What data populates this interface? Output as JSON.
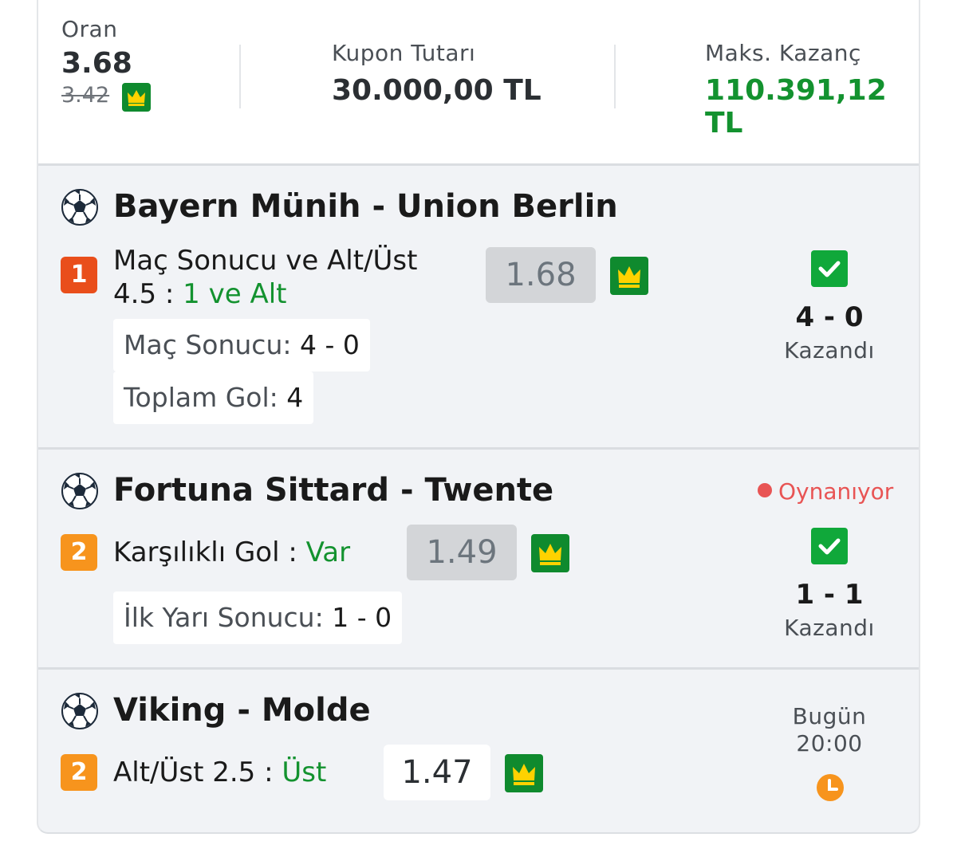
{
  "summary": {
    "odds_label": "Oran",
    "odds_value": "3.68",
    "odds_old": "3.42",
    "amount_label": "Kupon Tutarı",
    "amount_value": "30.000,00 TL",
    "max_win_label": "Maks. Kazanç",
    "max_win_value": "110.391,12 TL"
  },
  "matches": [
    {
      "title": "Bayern Münih - Union Berlin",
      "badge": "1",
      "badge_color": "#e94e1b",
      "market_line1": "Maç Sonucu ve Alt/Üst",
      "market_line2_prefix": "4.5 : ",
      "pick": "1 ve Alt",
      "odd": "1.68",
      "details": [
        {
          "label": "Maç Sonucu: ",
          "value": "4 - 0"
        },
        {
          "label": "Toplam Gol: ",
          "value": "4"
        }
      ],
      "score": "4 - 0",
      "status": "Kazandı"
    },
    {
      "title": "Fortuna Sittard - Twente",
      "live_label": "Oynanıyor",
      "badge": "2",
      "badge_color": "#f7941d",
      "market": "Karşılıklı Gol : ",
      "pick": "Var",
      "odd": "1.49",
      "details": [
        {
          "label": "İlk Yarı Sonucu: ",
          "value": "1 - 0"
        }
      ],
      "score": "1 - 1",
      "status": "Kazandı"
    },
    {
      "title": "Viking - Molde",
      "badge": "2",
      "badge_color": "#f7941d",
      "market": "Alt/Üst 2.5 : ",
      "pick": "Üst",
      "odd": "1.47",
      "day": "Bugün",
      "time": "20:00"
    }
  ],
  "colors": {
    "win_green": "#13922f",
    "crown_bg": "#0f8a2e",
    "check_green": "#10a83a",
    "live_red": "#e85454",
    "clock_orange": "#f7941d"
  },
  "icons": [
    "football-icon",
    "crown-icon",
    "check-icon",
    "clock-icon",
    "live-dot-icon"
  ]
}
